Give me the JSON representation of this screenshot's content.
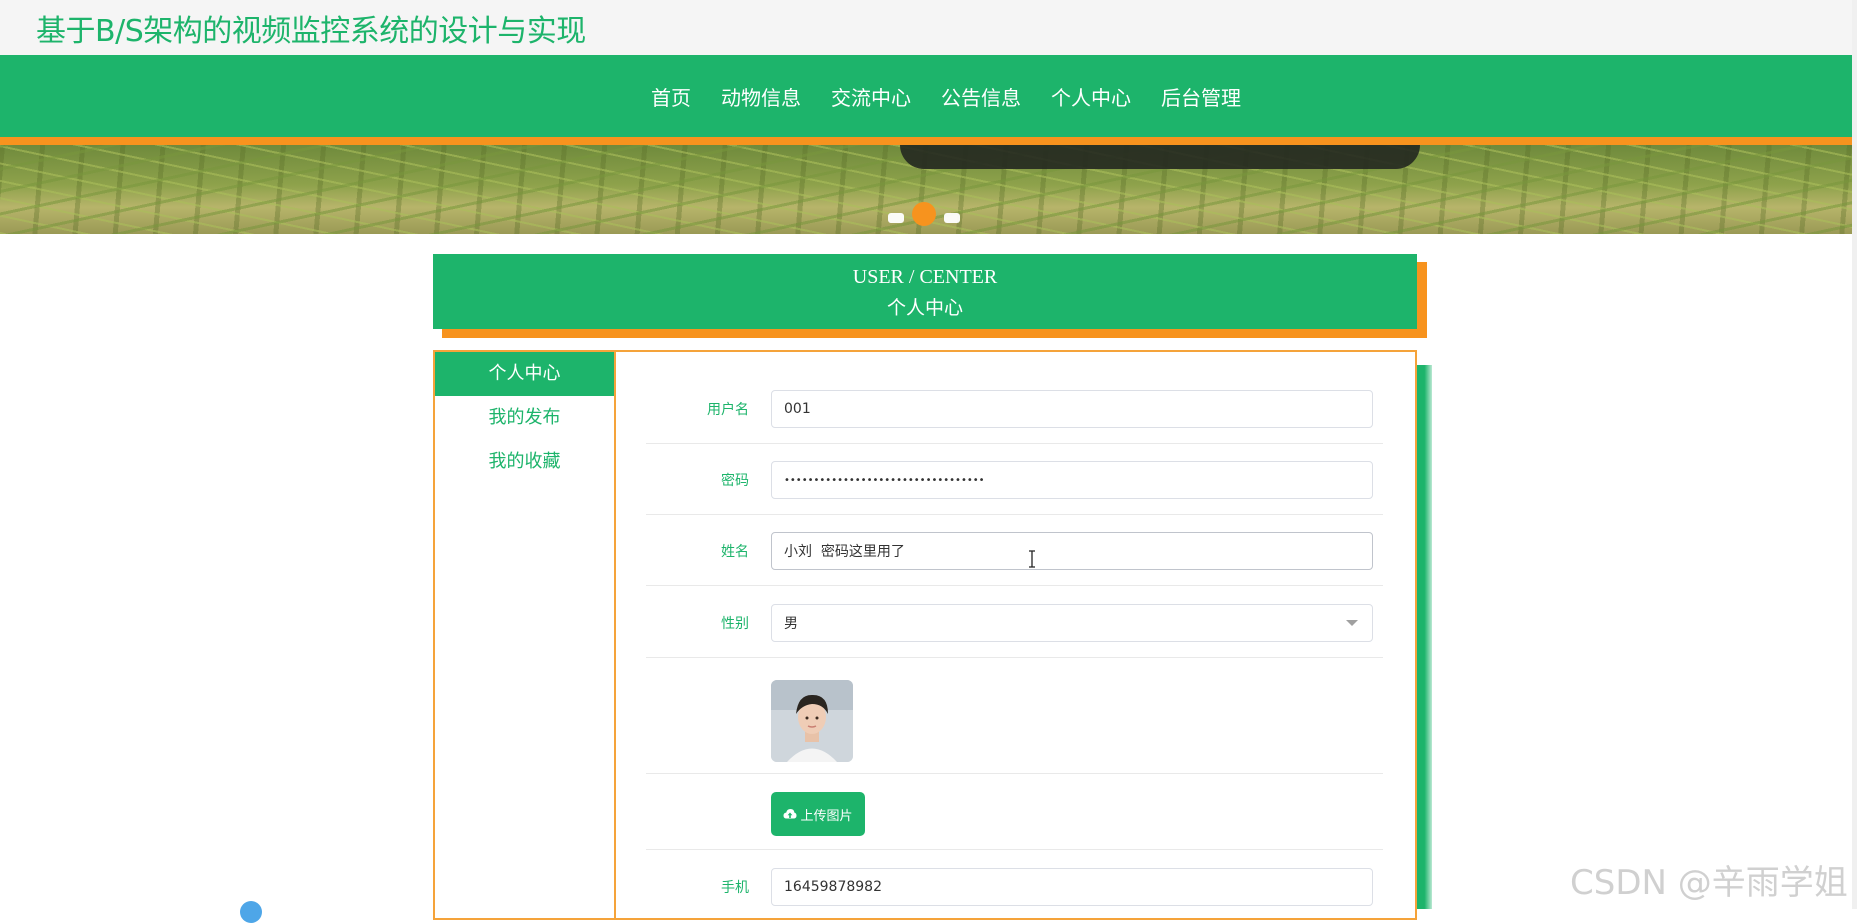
{
  "site": {
    "title": "基于B/S架构的视频监控系统的设计与实现"
  },
  "nav": {
    "items": [
      {
        "label": "首页"
      },
      {
        "label": "动物信息"
      },
      {
        "label": "交流中心"
      },
      {
        "label": "公告信息"
      },
      {
        "label": "个人中心"
      },
      {
        "label": "后台管理"
      }
    ]
  },
  "banner": {
    "slides": 3,
    "active_slide": 2
  },
  "section": {
    "title_en": "USER / CENTER",
    "title_cn": "个人中心"
  },
  "sidebar": {
    "items": [
      {
        "label": "个人中心",
        "active": true
      },
      {
        "label": "我的发布",
        "active": false
      },
      {
        "label": "我的收藏",
        "active": false
      }
    ]
  },
  "form": {
    "username": {
      "label": "用户名",
      "value": "001"
    },
    "password": {
      "label": "密码",
      "value": "••••••••••••••••••••••••••••••••••"
    },
    "name": {
      "label": "姓名",
      "value": "小刘  密码这里用了"
    },
    "gender": {
      "label": "性别",
      "value": "男"
    },
    "upload": {
      "label": "上传图片"
    },
    "phone": {
      "label": "手机",
      "value": "16459878982"
    }
  },
  "colors": {
    "brand_green": "#1db46b",
    "accent_orange": "#f7931e"
  },
  "watermark": "CSDN @辛雨学姐"
}
